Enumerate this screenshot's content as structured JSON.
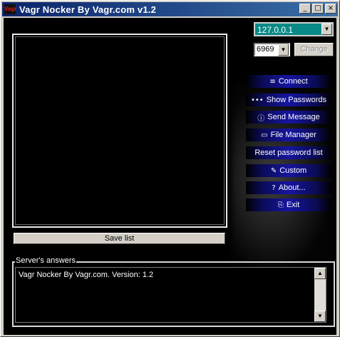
{
  "window": {
    "title": "Vagr Nocker By Vagr.com v1.2",
    "app_icon": "Vagr",
    "minimize_glyph": "_",
    "maximize_glyph": "□",
    "close_glyph": "×"
  },
  "connection": {
    "ip_value": "127.0.0.1",
    "port_value": "6969",
    "change_label": "Change",
    "dropdown_glyph": "▼"
  },
  "list": {
    "save_label": "Save list"
  },
  "menu": {
    "connect": {
      "label": "Connect",
      "icon": "≡"
    },
    "show_passwords": {
      "label": "Show Passwords",
      "icon": "•••"
    },
    "send_message": {
      "label": "Send Message",
      "icon": "ⓘ"
    },
    "file_manager": {
      "label": "File Manager",
      "icon": "▭"
    },
    "reset_password_list": {
      "label": "Reset password list"
    },
    "custom": {
      "label": "Custom",
      "icon": "✎"
    },
    "about": {
      "label": "About...",
      "icon": "?"
    },
    "exit": {
      "label": "Exit",
      "icon": "⎘"
    }
  },
  "answers": {
    "group_label": "Server's answers",
    "text": "Vagr Nocker By Vagr.com. Version: 1.2",
    "scroll_up": "▲",
    "scroll_down": "▼"
  }
}
